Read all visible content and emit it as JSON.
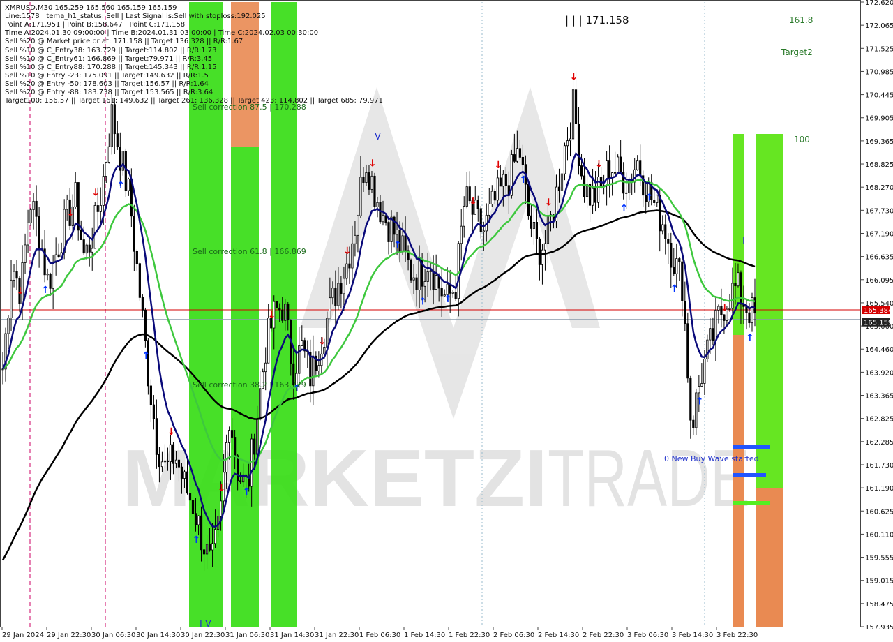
{
  "symbol_line": "XMRUSD,M30  165.259 165.560 165.159 165.159",
  "info_lines": [
    "Line:1578  | tema_h1_status: Sell  | Last Signal is:Sell with stoploss:192.025",
    "Point A:171.951 | Point B:158.647 | Point C:171.158",
    "Time A:2024.01.30 09:00:00 | Time B:2024.01.31 03:00:00 | Time C:2024.02.03 00:30:00",
    "Sell %20 @ Market price or at: 171.158 || Target:136.328 || R/R:1.67",
    "Sell %10 @ C_Entry38: 163.729 || Target:114.802 || R/R:1.73",
    "Sell %10 @ C_Entry61: 166.869 || Target:79.971 || R/R:3.45",
    "Sell %10 @ C_Entry88: 170.288 || Target:145.343 || R/R:1.15",
    "Sell %10 @ Entry -23: 175.091 || Target:149.632 || R/R:1.5",
    "Sell %20 @ Entry -50: 178.603 || Target:156.57 || R/R:1.64",
    "Sell %20 @ Entry -88: 183.738 || Target:153.565 || R/R:3.64",
    "Target100: 156.57 || Target 161: 149.632 || Target 261: 136.328 || Target 423: 114.802 || Target 685: 79.971"
  ],
  "annotations": {
    "peak_label": "| | | 171.158",
    "sell_corr_875": "Sell correction 87.5 | 170.288",
    "sell_corr_618": "Sell correction 61.8 | 166.869",
    "sell_corr_382": "Sell correction 38.2 | 163.729",
    "label_161": "161.8",
    "label_target2": "Target2",
    "label_100": "100",
    "new_wave": "0 New Buy Wave started",
    "wave_v": "V",
    "wave_iv": "I V",
    "wave_i": "I"
  },
  "price_tags": {
    "red": "165.384",
    "gray": "165.159"
  },
  "colors": {
    "bull_candle": "#000000",
    "bear_candle": "#000000",
    "ema_fast": "#0a0a7a",
    "ema_mid": "#3ec83e",
    "ema_slow": "#000000",
    "green_zone": "#33dd11",
    "orange_zone": "#e98a52",
    "sell_arrow": "#e00000",
    "buy_arrow": "#0033ff",
    "red_line": "#d40000",
    "gray_line": "#888888"
  },
  "chart_data": {
    "type": "candlestick",
    "title": "XMRUSD,M30",
    "ylim": [
      157.935,
      172.62
    ],
    "y_ticks": [
      "172.620",
      "172.065",
      "171.525",
      "170.985",
      "170.445",
      "169.905",
      "169.365",
      "168.825",
      "168.270",
      "167.730",
      "167.190",
      "166.635",
      "166.095",
      "165.540",
      "165.000",
      "164.460",
      "163.920",
      "163.365",
      "162.825",
      "162.285",
      "161.730",
      "161.190",
      "160.625",
      "160.110",
      "159.555",
      "159.015",
      "158.475",
      "157.935"
    ],
    "x_ticks": [
      "29 Jan 2024",
      "29 Jan 22:30",
      "30 Jan 06:30",
      "30 Jan 14:30",
      "30 Jan 22:30",
      "31 Jan 06:30",
      "31 Jan 14:30",
      "31 Jan 22:30",
      "1 Feb 06:30",
      "1 Feb 14:30",
      "1 Feb 22:30",
      "2 Feb 06:30",
      "2 Feb 14:30",
      "2 Feb 22:30",
      "3 Feb 06:30",
      "3 Feb 14:30",
      "3 Feb 22:30"
    ],
    "last_price": 165.159,
    "ask_line": 165.384,
    "close_path": [
      164.0,
      166.5,
      165.8,
      168.0,
      167.2,
      166.0,
      166.8,
      167.5,
      168.0,
      166.6,
      167.2,
      168.3,
      170.0,
      169.0,
      168.0,
      166.0,
      164.0,
      162.3,
      161.6,
      162.0,
      161.3,
      160.8,
      160.0,
      159.3,
      160.5,
      163.0,
      161.5,
      161.2,
      162.8,
      164.5,
      165.3,
      165.5,
      164.0,
      164.5,
      163.8,
      164.6,
      165.3,
      166.0,
      166.5,
      167.5,
      169.0,
      168.2,
      167.6,
      167.3,
      166.8,
      166.3,
      166.2,
      166.6,
      166.0,
      165.6,
      166.0,
      168.0,
      167.6,
      167.2,
      167.8,
      168.2,
      168.5,
      169.2,
      167.6,
      166.8,
      167.0,
      168.0,
      169.2,
      170.2,
      168.4,
      168.0,
      168.2,
      168.8,
      168.6,
      168.4,
      168.9,
      168.3,
      167.8,
      167.4,
      166.6,
      166.0,
      162.6,
      163.8,
      164.5,
      165.2,
      165.7,
      165.9,
      165.5,
      165.2
    ]
  }
}
